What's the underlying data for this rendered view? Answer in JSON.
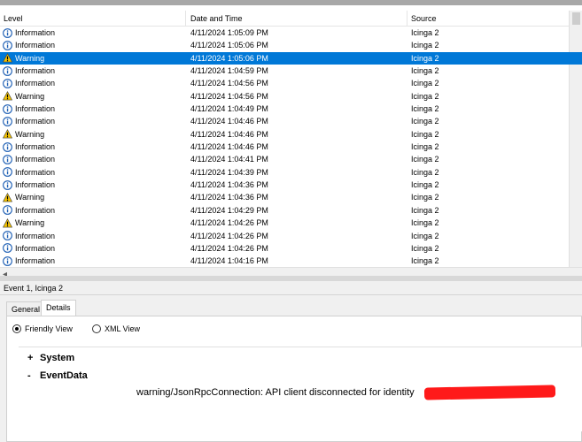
{
  "columns": {
    "level": "Level",
    "date_time": "Date and Time",
    "source": "Source"
  },
  "events": [
    {
      "level": "Information",
      "datetime": "4/11/2024 1:05:09 PM",
      "source": "Icinga 2",
      "icon": "information-icon"
    },
    {
      "level": "Information",
      "datetime": "4/11/2024 1:05:06 PM",
      "source": "Icinga 2",
      "icon": "information-icon"
    },
    {
      "level": "Warning",
      "datetime": "4/11/2024 1:05:06 PM",
      "source": "Icinga 2",
      "icon": "warning-icon",
      "selected": true
    },
    {
      "level": "Information",
      "datetime": "4/11/2024 1:04:59 PM",
      "source": "Icinga 2",
      "icon": "information-icon"
    },
    {
      "level": "Information",
      "datetime": "4/11/2024 1:04:56 PM",
      "source": "Icinga 2",
      "icon": "information-icon"
    },
    {
      "level": "Warning",
      "datetime": "4/11/2024 1:04:56 PM",
      "source": "Icinga 2",
      "icon": "warning-icon"
    },
    {
      "level": "Information",
      "datetime": "4/11/2024 1:04:49 PM",
      "source": "Icinga 2",
      "icon": "information-icon"
    },
    {
      "level": "Information",
      "datetime": "4/11/2024 1:04:46 PM",
      "source": "Icinga 2",
      "icon": "information-icon"
    },
    {
      "level": "Warning",
      "datetime": "4/11/2024 1:04:46 PM",
      "source": "Icinga 2",
      "icon": "warning-icon"
    },
    {
      "level": "Information",
      "datetime": "4/11/2024 1:04:46 PM",
      "source": "Icinga 2",
      "icon": "information-icon"
    },
    {
      "level": "Information",
      "datetime": "4/11/2024 1:04:41 PM",
      "source": "Icinga 2",
      "icon": "information-icon"
    },
    {
      "level": "Information",
      "datetime": "4/11/2024 1:04:39 PM",
      "source": "Icinga 2",
      "icon": "information-icon"
    },
    {
      "level": "Information",
      "datetime": "4/11/2024 1:04:36 PM",
      "source": "Icinga 2",
      "icon": "information-icon"
    },
    {
      "level": "Warning",
      "datetime": "4/11/2024 1:04:36 PM",
      "source": "Icinga 2",
      "icon": "warning-icon"
    },
    {
      "level": "Information",
      "datetime": "4/11/2024 1:04:29 PM",
      "source": "Icinga 2",
      "icon": "information-icon"
    },
    {
      "level": "Warning",
      "datetime": "4/11/2024 1:04:26 PM",
      "source": "Icinga 2",
      "icon": "warning-icon"
    },
    {
      "level": "Information",
      "datetime": "4/11/2024 1:04:26 PM",
      "source": "Icinga 2",
      "icon": "information-icon"
    },
    {
      "level": "Information",
      "datetime": "4/11/2024 1:04:26 PM",
      "source": "Icinga 2",
      "icon": "information-icon"
    },
    {
      "level": "Information",
      "datetime": "4/11/2024 1:04:16 PM",
      "source": "Icinga 2",
      "icon": "information-icon"
    }
  ],
  "detail": {
    "title": "Event 1, Icinga 2",
    "tabs": [
      "General",
      "Details"
    ],
    "active_tab": "Details",
    "view_options": {
      "friendly": "Friendly View",
      "xml": "XML View",
      "selected": "Friendly View"
    },
    "nodes": {
      "system": "System",
      "system_sign": "+",
      "eventdata": "EventData",
      "eventdata_sign": "-"
    },
    "message": "warning/JsonRpcConnection: API client disconnected for identity"
  },
  "colors": {
    "selection": "#0078d7",
    "info_icon": "#1e5fb4",
    "warning_icon": "#f5c400",
    "redaction": "#ff1a1a"
  }
}
